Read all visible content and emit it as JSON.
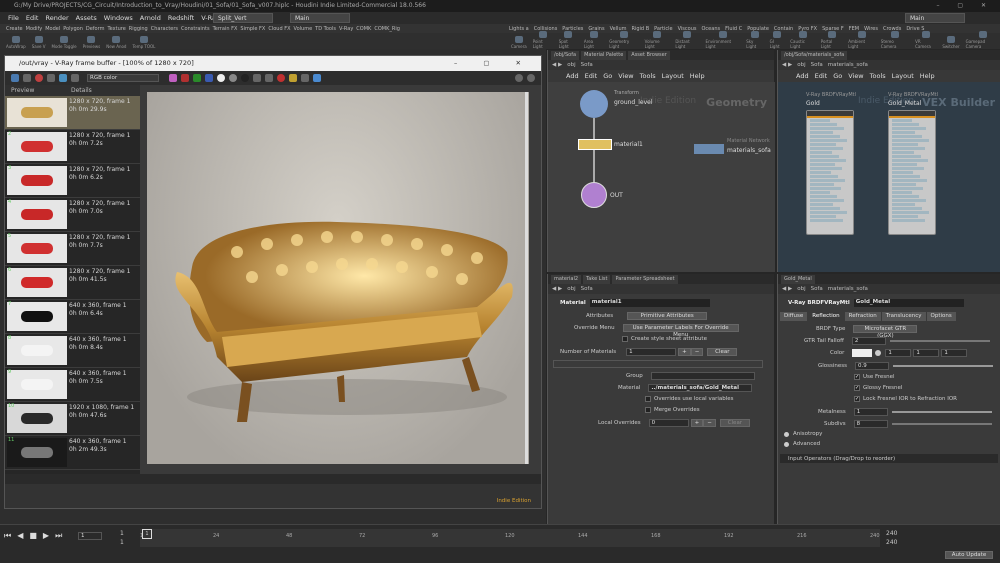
{
  "app": {
    "window_title": "G:/My Drive/PROJECTS/CG_Circuit/Introduction_to_Vray/Houdini/01_Sofa/01_Sofa_v007.hiplc - Houdini Indie Limited-Commercial 18.0.566",
    "menu": [
      "File",
      "Edit",
      "Render",
      "Assets",
      "Windows",
      "Arnold",
      "Redshift",
      "V-Ray",
      "Help"
    ],
    "desktop": "Split_Vert",
    "main_label": "Main",
    "main_label_right": "Main"
  },
  "shelf_left": {
    "tabs": [
      "Create",
      "Modify",
      "Model",
      "Polygon",
      "Deform",
      "Texture",
      "Rigging",
      "Characters",
      "Constraints",
      "Terrain FX",
      "Simple FX",
      "Cloud FX",
      "Volume",
      "TD Tools",
      "V-Ray",
      "COMK",
      "COMK_Rig"
    ],
    "icons": [
      "AutoWrap",
      "Save V",
      "Mode Toggle",
      "Previews",
      "New Anod",
      "Temp TOOL"
    ]
  },
  "shelf_right": {
    "tabs": [
      "Lights a",
      "Collisions",
      "Particles",
      "Grains",
      "Vellum",
      "Rigid B",
      "Particle",
      "Viscous",
      "Oceans",
      "Fluid C",
      "Populate",
      "Contain",
      "Pyro FX",
      "Sparse F",
      "FEM",
      "Wires",
      "Crowds",
      "Drive S"
    ],
    "icons": [
      "Camera",
      "Point Light",
      "Spot Light",
      "Area Light",
      "Geometry Light",
      "Volume Light",
      "Distant Light",
      "Environment Light",
      "Sky Light",
      "GI Light",
      "Caustic Light",
      "Portal Light",
      "Ambient Light",
      "Stereo Camera",
      "VR Camera",
      "Switcher",
      "Gamepad Camera"
    ]
  },
  "vfb": {
    "title": "/out/vray - V-Ray frame buffer - [100% of 1280 x 720]",
    "channel": "RGB color",
    "history_headers": [
      "Preview",
      "Details"
    ],
    "history": [
      {
        "num": "",
        "res": "1280 x 720, frame 1",
        "time": "0h 0m 29.9s",
        "color": "#e8e2d6",
        "sofa": "#c8a050"
      },
      {
        "num": "2",
        "res": "1280 x 720, frame 1",
        "time": "0h 0m 7.2s",
        "color": "#e6e6e6",
        "sofa": "#d03030"
      },
      {
        "num": "3",
        "res": "1280 x 720, frame 1",
        "time": "0h 0m 6.2s",
        "color": "#e6e6e6",
        "sofa": "#c82828"
      },
      {
        "num": "4",
        "res": "1280 x 720, frame 1",
        "time": "0h 0m 7.0s",
        "color": "#e6e6e6",
        "sofa": "#c82828"
      },
      {
        "num": "5",
        "res": "1280 x 720, frame 1",
        "time": "0h 0m 7.7s",
        "color": "#e6e6e6",
        "sofa": "#d03030"
      },
      {
        "num": "6",
        "res": "1280 x 720, frame 1",
        "time": "0h 0m 41.5s",
        "color": "#e6e6e6",
        "sofa": "#d02a2a"
      },
      {
        "num": "7",
        "res": "640 x 360, frame 1",
        "time": "0h 0m 6.4s",
        "color": "#e8e8e8",
        "sofa": "#111111"
      },
      {
        "num": "8",
        "res": "640 x 360, frame 1",
        "time": "0h 0m 8.4s",
        "color": "#e8e8e8",
        "sofa": "#f4f4f4"
      },
      {
        "num": "9",
        "res": "640 x 360, frame 1",
        "time": "0h 0m 7.5s",
        "color": "#e8e8e8",
        "sofa": "#f4f4f4"
      },
      {
        "num": "10",
        "res": "1920 x 1080, frame 1",
        "time": "0h 0m 47.6s",
        "color": "#d8d8d8",
        "sofa": "#2a2a2a"
      },
      {
        "num": "11",
        "res": "640 x 360, frame 1",
        "time": "0h 2m 49.3s",
        "color": "#1a1a1a",
        "sofa": "#777777"
      }
    ],
    "edition": "Indie Edition"
  },
  "network": {
    "tabs": [
      "/obj/Sofa",
      "Material Palette",
      "Asset Browser"
    ],
    "path": [
      "obj",
      "Sofa"
    ],
    "menu": [
      "Add",
      "Edit",
      "Go",
      "View",
      "Tools",
      "Layout",
      "Help"
    ],
    "watermark_edition": "Indie Edition",
    "context": "Geometry",
    "nodes": {
      "transform": "Transform",
      "ground": "ground_level",
      "material": "material1",
      "out": "OUT",
      "matnet_type": "Material Network",
      "matnet": "materials_sofa"
    }
  },
  "matnet": {
    "tabs": [
      "/obj/Sofa/materials_sofa"
    ],
    "path": [
      "obj",
      "Sofa",
      "materials_sofa"
    ],
    "menu": [
      "Add",
      "Edit",
      "Go",
      "View",
      "Tools",
      "Layout",
      "Help"
    ],
    "watermark": "Indie Edition",
    "context": "VEX Builder",
    "node_type_a": "V-Ray BRDFVRayMtl",
    "node_a": "Gold",
    "node_type_b": "V-Ray BRDFVRayMtl",
    "node_b": "Gold_Metal"
  },
  "parm_left": {
    "tabs": [
      "material2",
      "Take List",
      "Parameter Spreadsheet"
    ],
    "path": [
      "obj",
      "Sofa"
    ],
    "node_type": "Material",
    "node_name": "material1",
    "attributes_label": "Attributes",
    "attributes_value": "Primitive Attributes",
    "override_menu_label": "Override Menu",
    "override_menu_value": "Use Parameter Labels For Override Menu",
    "create_style": "Create style sheet attribute",
    "num_materials_label": "Number of Materials",
    "num_materials_value": "1",
    "clear": "Clear",
    "group_label": "Group",
    "material_label": "Material",
    "material_value": "../materials_sofa/Gold_Metal",
    "overrides_local": "Overrides use local variables",
    "merge_overrides": "Merge Overrides",
    "local_overrides_label": "Local Overrides",
    "local_overrides_value": "0",
    "clear2": "Clear"
  },
  "parm_right": {
    "tabs": [
      "Gold_Metal"
    ],
    "path": [
      "obj",
      "Sofa",
      "materials_sofa"
    ],
    "node_type": "V-Ray BRDFVRayMtl",
    "node_name": "Gold_Metal",
    "subtabs": [
      "Diffuse",
      "Reflection",
      "Refraction",
      "Translucency",
      "Options"
    ],
    "brdf_label": "BRDF Type",
    "brdf_value": "Microfacet GTR (GGX)",
    "gtr_label": "GTR Tail Falloff",
    "gtr_value": "2",
    "color_label": "Color",
    "color_values": [
      "1",
      "1",
      "1"
    ],
    "gloss_label": "Glossiness",
    "gloss_value": "0.9",
    "use_fresnel": "Use Fresnel",
    "glossy_fresnel": "Glossy Fresnel",
    "lock_fresnel": "Lock Fresnel IOR to Refraction IOR",
    "metalness_label": "Metalness",
    "metalness_value": "1",
    "subdivs_label": "Subdivs",
    "subdivs_value": "8",
    "anisotropy": "Anisotropy",
    "advanced": "Advanced",
    "input_operators": "Input Operators (Drag/Drop to reorder)"
  },
  "timeline": {
    "frame": "1",
    "start": "1",
    "start2": "1",
    "ticks": [
      "1",
      "24",
      "48",
      "72",
      "96",
      "120",
      "144",
      "168",
      "192",
      "216",
      "240"
    ],
    "end": "240",
    "end2": "240",
    "auto_update": "Auto Update"
  }
}
